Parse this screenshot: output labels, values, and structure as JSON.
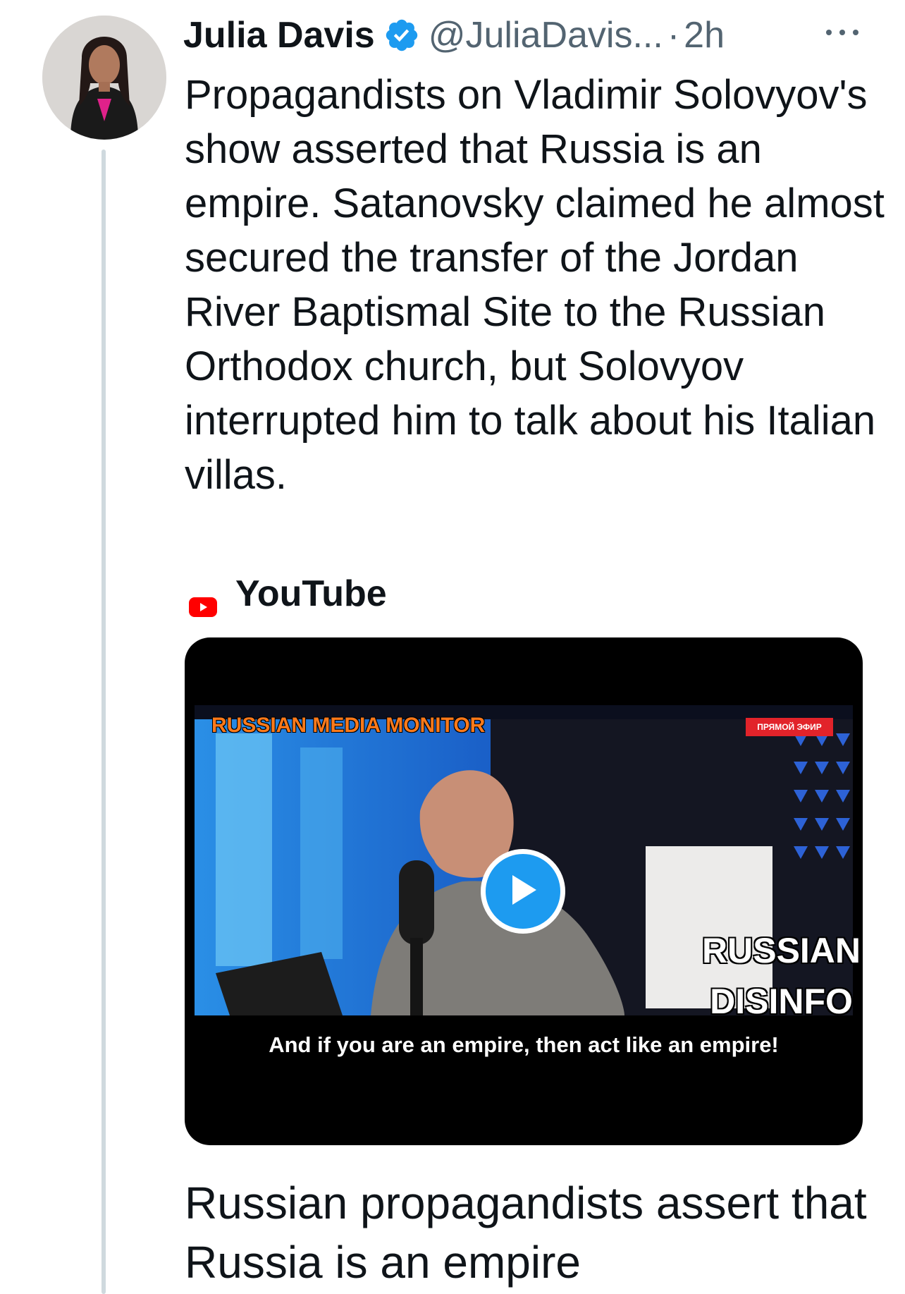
{
  "author": {
    "name": "Julia Davis",
    "handle": "@JuliaDavis...",
    "separator": "·",
    "time": "2h",
    "verified_icon": "verified-badge-icon",
    "verified_color": "#1d9bf0"
  },
  "tweet": {
    "text": "Propagandists on Vladimir Solovyov's show asserted that Russia is an empire. Satanovsky claimed he almost secured the transfer of the Jordan River Baptismal Site to the Russian Orthodox church, but Solovyov interrupted him to talk about his Italian villas."
  },
  "link_card": {
    "source": "YouTube",
    "source_icon": "youtube-icon",
    "video": {
      "overlay_title": "RUSSIAN MEDIA MONITOR",
      "overlay_badge_line1": "RUSSIAN",
      "overlay_badge_line2": "DISINFO",
      "subtitle": "And if you are an empire, then act like an empire!",
      "live_badge": "ПРЯМОЙ ЭФИР",
      "play_icon": "play-icon",
      "play_color": "#1d9bf0"
    },
    "title": "Russian propagandists assert that Russia is an empire"
  },
  "more_icon": "more-icon"
}
